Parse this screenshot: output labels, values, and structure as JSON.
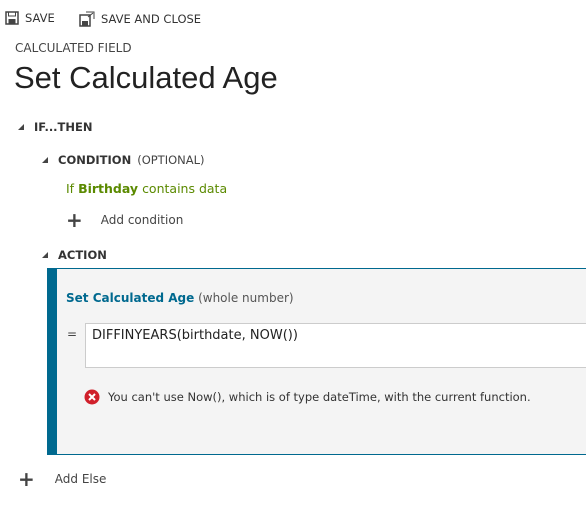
{
  "toolbar": {
    "save": "SAVE",
    "save_close": "SAVE AND CLOSE"
  },
  "header": {
    "subtitle": "CALCULATED FIELD",
    "title": "Set Calculated Age"
  },
  "ifthen": {
    "label": "IF...THEN"
  },
  "condition": {
    "label": "CONDITION",
    "optional": "(OPTIONAL)",
    "if": "If",
    "field": "Birthday",
    "op": "contains data",
    "add": "Add condition"
  },
  "action": {
    "label": "ACTION",
    "target": "Set Calculated Age",
    "type": "(whole number)",
    "eq": "=",
    "formula": "DIFFINYEARS(birthdate, NOW())",
    "error": "You can't use Now(), which is of type dateTime, with the current function."
  },
  "else": {
    "add": "Add Else"
  },
  "colors": {
    "accent": "#00698f",
    "condition": "#5b8a00",
    "error": "#d01f2a"
  }
}
